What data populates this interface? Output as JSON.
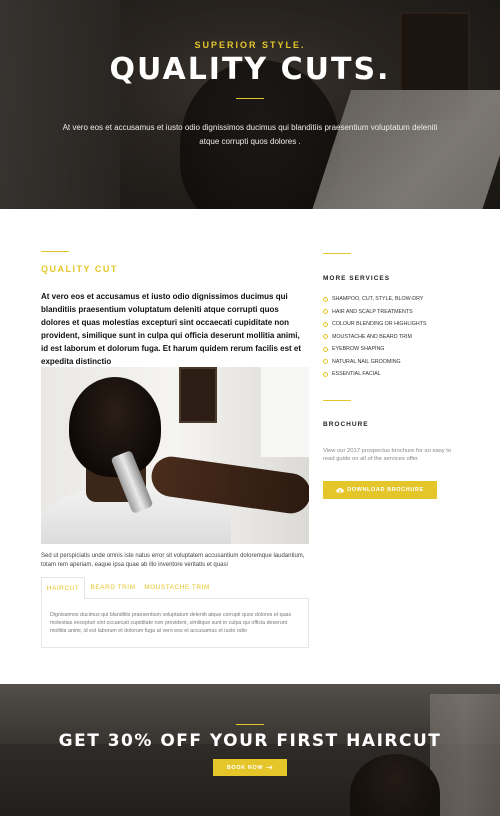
{
  "hero": {
    "kicker": "SUPERIOR STYLE.",
    "title": "QUALITY CUTS.",
    "lead": "At vero eos et accusamus et iusto odio dignissimos ducimus qui blanditiis praesentium voluptatum deleniti atque corrupti quos dolores ."
  },
  "main": {
    "section_title": "QUALITY CUT",
    "intro": "At vero eos et accusamus et iusto odio dignissimos ducimus qui blanditiis praesentium voluptatum deleniti atque corrupti quos dolores et quas molestias excepturi sint occaecati cupiditate non provident, similique sunt in culpa qui officia deserunt mollitia animi, id est laborum et dolorum fuga. Et harum quidem rerum facilis est et expedita distinctio",
    "caption": "Sed ut perspiciatis unde omnis iste natus error sit voluptatem accusantium doloremque laudantium, totam rem aperiam, eaque ipsa quae ab illo inventore veritatis et quasi",
    "tabs": [
      {
        "label": "HAIRCUT",
        "active": true
      },
      {
        "label": "BEARD TRIM",
        "active": false
      },
      {
        "label": "MOUSTACHE TRIM",
        "active": false
      }
    ],
    "tab_content": "Dignissimos ducimus qui blanditiis praesentium voluptatum deleniti atque corrupti quos dolores et quas molestias excepturi sint occaecati cupiditate non provident, similique sunt in culpa qui officia deserunt mollitia animi, id est laborum et dolorum fuga at vero eos et accusamus et iusto odio"
  },
  "sidebar": {
    "services_heading": "MORE SERVICES",
    "services": [
      "SHAMPOO, CUT, STYLE, BLOW-DRY",
      "HAIR AND SCALP TREATMENTS",
      "COLOUR BLENDING OR HIGHLIGHTS",
      "MOUSTACHE AND BEARD TRIM",
      "EYEBROW SHAPING",
      "NATURAL NAIL GROOMING",
      "ESSENTIAL FACIAL"
    ],
    "brochure_heading": "BROCHURE",
    "brochure_text": "View our 2017 prospectus brochure for an easy to read guide on all of the services offer.",
    "brochure_button": "DOWNLOAD BROCHURE",
    "download_icon": "cloud-download-icon"
  },
  "promo": {
    "title": "GET 30% OFF YOUR FIRST HAIRCUT",
    "button": "BOOK NOW",
    "arrow_icon": "arrow-right-icon"
  },
  "colors": {
    "accent": "#e4c62a",
    "text_dark": "#111111",
    "text_muted": "#888888"
  }
}
